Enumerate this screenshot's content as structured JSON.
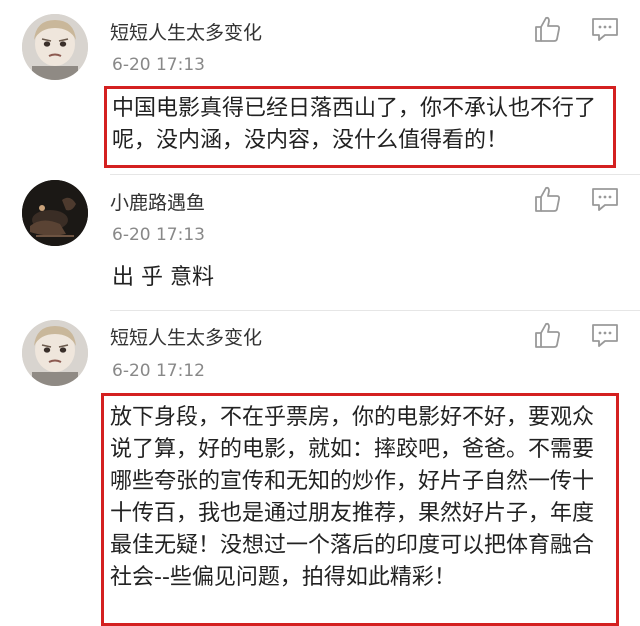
{
  "comments": [
    {
      "username": "短短人生太多变化",
      "timestamp": "6-20 17:13",
      "text": "中国电影真得已经日落西山了，你不承认也不行了呢，没内涵，没内容，没什么值得看的！",
      "highlighted": true
    },
    {
      "username": "小鹿路遇鱼",
      "timestamp": "6-20 17:13",
      "text": "出 乎 意料",
      "highlighted": false
    },
    {
      "username": "短短人生太多变化",
      "timestamp": "6-20 17:12",
      "text": "放下身段，不在乎票房，你的电影好不好，要观众说了算，好的电影，就如：摔跤吧，爸爸。不需要哪些夸张的宣传和无知的炒作，好片子自然一传十十传百，我也是通过朋友推荐，果然好片子，年度最佳无疑！没想过一个落后的印度可以把体育融合社会--些偏见问题，拍得如此精彩！",
      "highlighted": true
    }
  ],
  "icons": {
    "like": "thumbs-up-icon",
    "reply": "comment-bubble-icon"
  },
  "colors": {
    "highlight_border": "#d42020",
    "timestamp": "#888888",
    "icon": "#999999"
  }
}
